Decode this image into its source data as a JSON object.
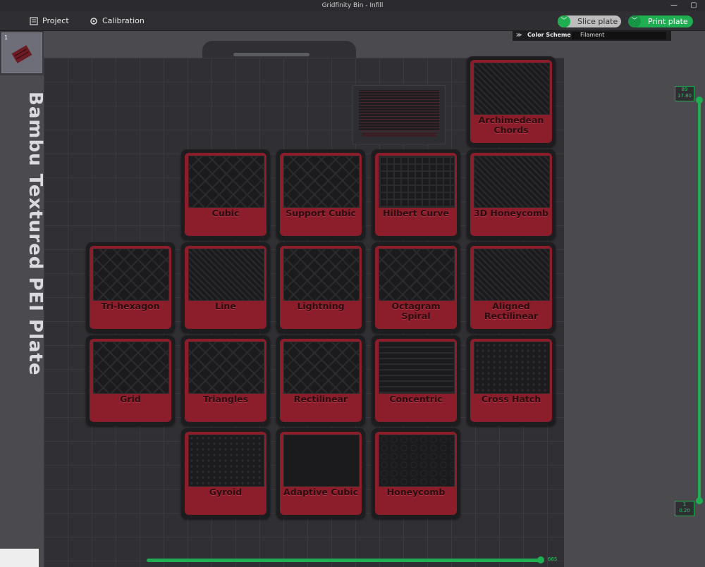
{
  "window": {
    "title": "Gridfinity Bin - Infill",
    "minimize": "—",
    "maximize": "▢"
  },
  "toolbar": {
    "project": "Project",
    "calibration": "Calibration",
    "slice_plate": "Slice plate",
    "print_plate": "Print plate",
    "dropdown": "﹀"
  },
  "plate_thumb": {
    "number": "1"
  },
  "color_scheme": {
    "label": "Color Scheme",
    "value": "Filament"
  },
  "plate": {
    "name": "Bambu Textured PEI Plate"
  },
  "layer_slider": {
    "top_value": "89",
    "top_height": "17.80",
    "bottom_value": "1",
    "bottom_height": "0.20"
  },
  "move_slider": {
    "value": "665"
  },
  "tiles": [
    {
      "label": "Archimedean Chords"
    },
    {
      "label": "Cubic"
    },
    {
      "label": "Support Cubic"
    },
    {
      "label": "Hilbert Curve"
    },
    {
      "label": "3D Honeycomb"
    },
    {
      "label": "Tri-hexagon"
    },
    {
      "label": "Line"
    },
    {
      "label": "Lightning"
    },
    {
      "label": "Octagram Spiral"
    },
    {
      "label": "Aligned Rectilinear"
    },
    {
      "label": "Grid"
    },
    {
      "label": "Triangles"
    },
    {
      "label": "Rectilinear"
    },
    {
      "label": "Concentric"
    },
    {
      "label": "Cross Hatch"
    },
    {
      "label": "Gyroid"
    },
    {
      "label": "Adaptive Cubic"
    },
    {
      "label": "Honeycomb"
    }
  ]
}
